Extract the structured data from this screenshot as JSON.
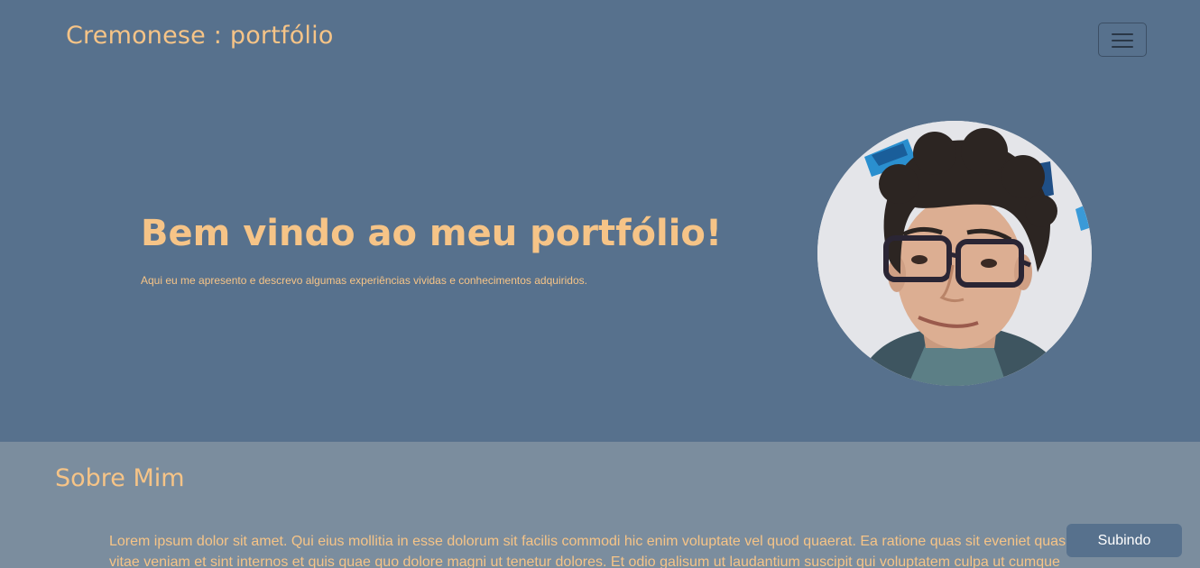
{
  "navbar": {
    "brand": "Cremonese : portfólio",
    "menu_icon": "hamburger-menu-icon"
  },
  "hero": {
    "title": "Bem vindo ao meu portfólio!",
    "subtitle": "Aqui eu me apresento e descrevo algumas experiências vividas e conhecimentos adquiridos.",
    "photo": "profile-photo"
  },
  "about": {
    "title": "Sobre Mim",
    "text": "Lorem ipsum dolor sit amet. Qui eius mollitia in esse dolorum sit facilis commodi hic enim voluptate vel quod quaerat. Ea ratione quas sit eveniet quasi vitae veniam et sint internos et quis quae quo dolore magni ut tenetur dolores. Et odio galisum ut laudantium suscipit qui voluptatem culpa ut cumque"
  },
  "scroll_button": {
    "label": "Subindo"
  },
  "colors": {
    "hero_background": "#57718d",
    "section_background": "#7b8d9e",
    "accent_text": "#f6c487"
  }
}
